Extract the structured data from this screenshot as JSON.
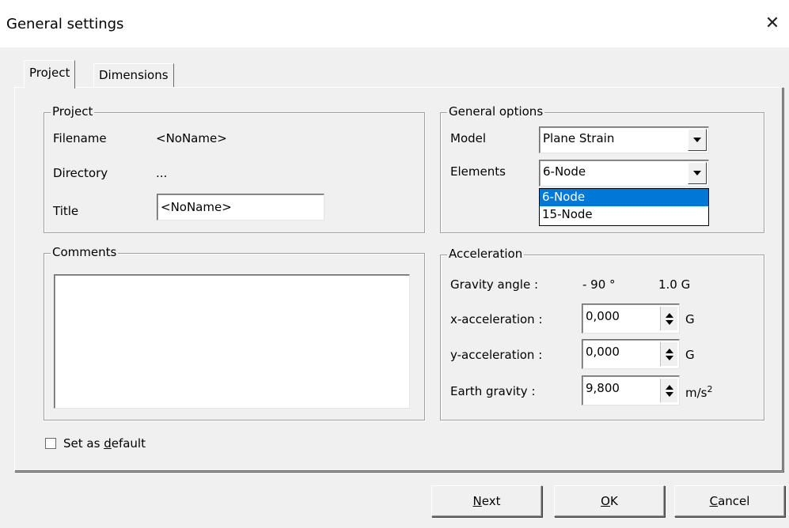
{
  "window": {
    "title": "General settings",
    "close_glyph": "✕"
  },
  "tabs": [
    {
      "label": "Project",
      "active": true
    },
    {
      "label": "Dimensions",
      "active": false
    }
  ],
  "project_group": {
    "title": "Project",
    "filename_label": "Filename",
    "filename_value": "<NoName>",
    "directory_label": "Directory",
    "directory_value": "...",
    "title_label": "Title",
    "title_value": "<NoName>"
  },
  "comments_group": {
    "title": "Comments",
    "value": ""
  },
  "general_options": {
    "title": "General options",
    "model_label": "Model",
    "model_value": "Plane Strain",
    "elements_label": "Elements",
    "elements_value": "6-Node",
    "elements_options": [
      "6-Node",
      "15-Node"
    ],
    "elements_selected": "6-Node"
  },
  "acceleration": {
    "title": "Acceleration",
    "gravity_angle_label": "Gravity angle :",
    "gravity_angle_value": "- 90 °",
    "gravity_g_value": "1.0 G",
    "x_label": "x-acceleration :",
    "x_value": "0,000",
    "x_unit": "G",
    "y_label": "y-acceleration :",
    "y_value": "0,000",
    "y_unit": "G",
    "earth_label": "Earth gravity :",
    "earth_value": "9,800",
    "earth_unit": "m/s",
    "earth_unit_sup": "2"
  },
  "default_checkbox": {
    "label_pre": "Set as ",
    "label_u": "d",
    "label_post": "efault",
    "checked": false
  },
  "buttons": {
    "next": {
      "u": "N",
      "rest": "ext"
    },
    "ok": {
      "u": "O",
      "rest": "K"
    },
    "cancel": {
      "u": "C",
      "rest": "ancel"
    }
  },
  "colors": {
    "selection": "#0078d7",
    "dialog_bg": "#f0f0f0"
  }
}
